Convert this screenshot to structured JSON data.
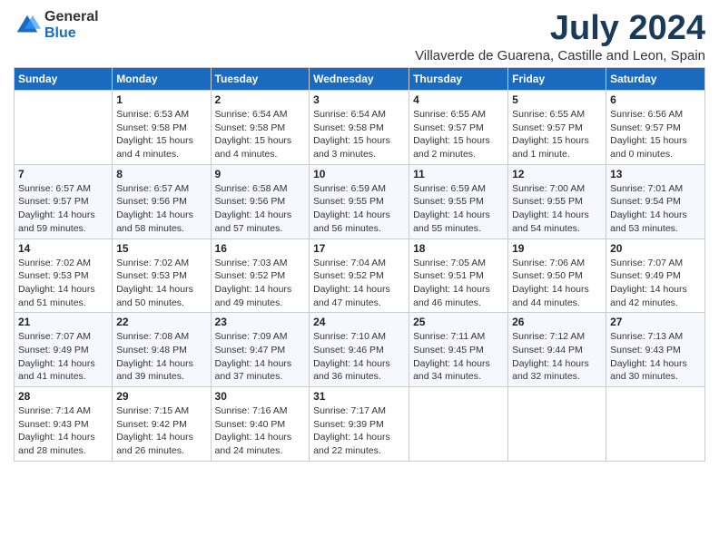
{
  "logo": {
    "general": "General",
    "blue": "Blue"
  },
  "title": "July 2024",
  "location": "Villaverde de Guarena, Castille and Leon, Spain",
  "headers": [
    "Sunday",
    "Monday",
    "Tuesday",
    "Wednesday",
    "Thursday",
    "Friday",
    "Saturday"
  ],
  "weeks": [
    [
      {
        "day": "",
        "sunrise": "",
        "sunset": "",
        "daylight": ""
      },
      {
        "day": "1",
        "sunrise": "Sunrise: 6:53 AM",
        "sunset": "Sunset: 9:58 PM",
        "daylight": "Daylight: 15 hours and 4 minutes."
      },
      {
        "day": "2",
        "sunrise": "Sunrise: 6:54 AM",
        "sunset": "Sunset: 9:58 PM",
        "daylight": "Daylight: 15 hours and 4 minutes."
      },
      {
        "day": "3",
        "sunrise": "Sunrise: 6:54 AM",
        "sunset": "Sunset: 9:58 PM",
        "daylight": "Daylight: 15 hours and 3 minutes."
      },
      {
        "day": "4",
        "sunrise": "Sunrise: 6:55 AM",
        "sunset": "Sunset: 9:57 PM",
        "daylight": "Daylight: 15 hours and 2 minutes."
      },
      {
        "day": "5",
        "sunrise": "Sunrise: 6:55 AM",
        "sunset": "Sunset: 9:57 PM",
        "daylight": "Daylight: 15 hours and 1 minute."
      },
      {
        "day": "6",
        "sunrise": "Sunrise: 6:56 AM",
        "sunset": "Sunset: 9:57 PM",
        "daylight": "Daylight: 15 hours and 0 minutes."
      }
    ],
    [
      {
        "day": "7",
        "sunrise": "Sunrise: 6:57 AM",
        "sunset": "Sunset: 9:57 PM",
        "daylight": "Daylight: 14 hours and 59 minutes."
      },
      {
        "day": "8",
        "sunrise": "Sunrise: 6:57 AM",
        "sunset": "Sunset: 9:56 PM",
        "daylight": "Daylight: 14 hours and 58 minutes."
      },
      {
        "day": "9",
        "sunrise": "Sunrise: 6:58 AM",
        "sunset": "Sunset: 9:56 PM",
        "daylight": "Daylight: 14 hours and 57 minutes."
      },
      {
        "day": "10",
        "sunrise": "Sunrise: 6:59 AM",
        "sunset": "Sunset: 9:55 PM",
        "daylight": "Daylight: 14 hours and 56 minutes."
      },
      {
        "day": "11",
        "sunrise": "Sunrise: 6:59 AM",
        "sunset": "Sunset: 9:55 PM",
        "daylight": "Daylight: 14 hours and 55 minutes."
      },
      {
        "day": "12",
        "sunrise": "Sunrise: 7:00 AM",
        "sunset": "Sunset: 9:55 PM",
        "daylight": "Daylight: 14 hours and 54 minutes."
      },
      {
        "day": "13",
        "sunrise": "Sunrise: 7:01 AM",
        "sunset": "Sunset: 9:54 PM",
        "daylight": "Daylight: 14 hours and 53 minutes."
      }
    ],
    [
      {
        "day": "14",
        "sunrise": "Sunrise: 7:02 AM",
        "sunset": "Sunset: 9:53 PM",
        "daylight": "Daylight: 14 hours and 51 minutes."
      },
      {
        "day": "15",
        "sunrise": "Sunrise: 7:02 AM",
        "sunset": "Sunset: 9:53 PM",
        "daylight": "Daylight: 14 hours and 50 minutes."
      },
      {
        "day": "16",
        "sunrise": "Sunrise: 7:03 AM",
        "sunset": "Sunset: 9:52 PM",
        "daylight": "Daylight: 14 hours and 49 minutes."
      },
      {
        "day": "17",
        "sunrise": "Sunrise: 7:04 AM",
        "sunset": "Sunset: 9:52 PM",
        "daylight": "Daylight: 14 hours and 47 minutes."
      },
      {
        "day": "18",
        "sunrise": "Sunrise: 7:05 AM",
        "sunset": "Sunset: 9:51 PM",
        "daylight": "Daylight: 14 hours and 46 minutes."
      },
      {
        "day": "19",
        "sunrise": "Sunrise: 7:06 AM",
        "sunset": "Sunset: 9:50 PM",
        "daylight": "Daylight: 14 hours and 44 minutes."
      },
      {
        "day": "20",
        "sunrise": "Sunrise: 7:07 AM",
        "sunset": "Sunset: 9:49 PM",
        "daylight": "Daylight: 14 hours and 42 minutes."
      }
    ],
    [
      {
        "day": "21",
        "sunrise": "Sunrise: 7:07 AM",
        "sunset": "Sunset: 9:49 PM",
        "daylight": "Daylight: 14 hours and 41 minutes."
      },
      {
        "day": "22",
        "sunrise": "Sunrise: 7:08 AM",
        "sunset": "Sunset: 9:48 PM",
        "daylight": "Daylight: 14 hours and 39 minutes."
      },
      {
        "day": "23",
        "sunrise": "Sunrise: 7:09 AM",
        "sunset": "Sunset: 9:47 PM",
        "daylight": "Daylight: 14 hours and 37 minutes."
      },
      {
        "day": "24",
        "sunrise": "Sunrise: 7:10 AM",
        "sunset": "Sunset: 9:46 PM",
        "daylight": "Daylight: 14 hours and 36 minutes."
      },
      {
        "day": "25",
        "sunrise": "Sunrise: 7:11 AM",
        "sunset": "Sunset: 9:45 PM",
        "daylight": "Daylight: 14 hours and 34 minutes."
      },
      {
        "day": "26",
        "sunrise": "Sunrise: 7:12 AM",
        "sunset": "Sunset: 9:44 PM",
        "daylight": "Daylight: 14 hours and 32 minutes."
      },
      {
        "day": "27",
        "sunrise": "Sunrise: 7:13 AM",
        "sunset": "Sunset: 9:43 PM",
        "daylight": "Daylight: 14 hours and 30 minutes."
      }
    ],
    [
      {
        "day": "28",
        "sunrise": "Sunrise: 7:14 AM",
        "sunset": "Sunset: 9:43 PM",
        "daylight": "Daylight: 14 hours and 28 minutes."
      },
      {
        "day": "29",
        "sunrise": "Sunrise: 7:15 AM",
        "sunset": "Sunset: 9:42 PM",
        "daylight": "Daylight: 14 hours and 26 minutes."
      },
      {
        "day": "30",
        "sunrise": "Sunrise: 7:16 AM",
        "sunset": "Sunset: 9:40 PM",
        "daylight": "Daylight: 14 hours and 24 minutes."
      },
      {
        "day": "31",
        "sunrise": "Sunrise: 7:17 AM",
        "sunset": "Sunset: 9:39 PM",
        "daylight": "Daylight: 14 hours and 22 minutes."
      },
      {
        "day": "",
        "sunrise": "",
        "sunset": "",
        "daylight": ""
      },
      {
        "day": "",
        "sunrise": "",
        "sunset": "",
        "daylight": ""
      },
      {
        "day": "",
        "sunrise": "",
        "sunset": "",
        "daylight": ""
      }
    ]
  ]
}
